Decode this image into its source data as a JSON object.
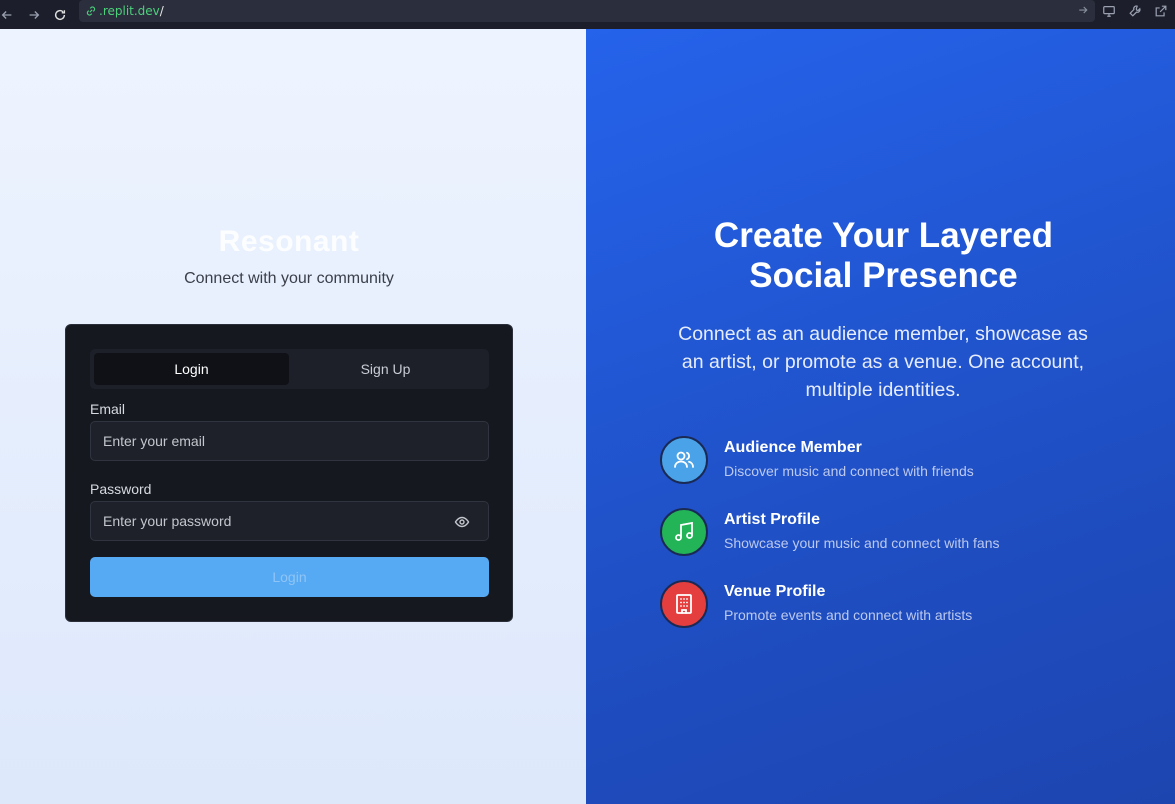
{
  "browser": {
    "url_host": ".replit.dev",
    "url_path": "/"
  },
  "brand": {
    "name": "Resonant",
    "tagline": "Connect with your community"
  },
  "auth": {
    "tabs": [
      {
        "label": "Login",
        "active": true
      },
      {
        "label": "Sign Up",
        "active": false
      }
    ],
    "email_label": "Email",
    "email_placeholder": "Enter your email",
    "password_label": "Password",
    "password_placeholder": "Enter your password",
    "submit_label": "Login"
  },
  "promo": {
    "headline_line1": "Create Your Layered",
    "headline_line2": "Social Presence",
    "subtext": "Connect as an audience member, showcase as an artist, or promote as a venue. One account, multiple identities.",
    "features": [
      {
        "title": "Audience Member",
        "description": "Discover music and connect with friends",
        "icon": "users-icon",
        "color": "#4aa3e8"
      },
      {
        "title": "Artist Profile",
        "description": "Showcase your music and connect with fans",
        "icon": "music-icon",
        "color": "#22b457"
      },
      {
        "title": "Venue Profile",
        "description": "Promote events and connect with artists",
        "icon": "building-icon",
        "color": "#e53e3e"
      }
    ]
  },
  "colors": {
    "accent": "#2563eb",
    "button": "#56a9f3"
  }
}
